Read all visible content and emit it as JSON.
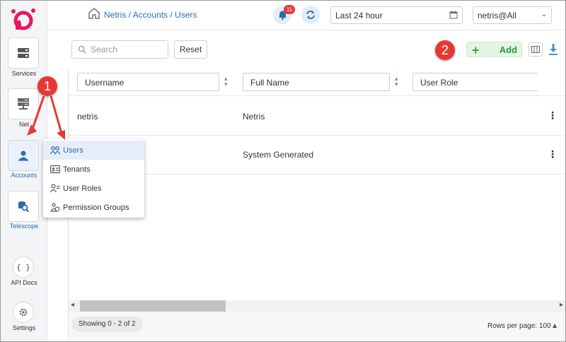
{
  "header": {
    "breadcrumb": "Netris / Accounts / Users",
    "notification_count": "11",
    "time_range": "Last 24 hour",
    "tenant": "netris@All"
  },
  "sidebar": {
    "items": [
      {
        "label": "Services",
        "icon": "services-icon"
      },
      {
        "label": "Net",
        "icon": "net-icon"
      },
      {
        "label": "Accounts",
        "icon": "accounts-icon"
      },
      {
        "label": "Telescope",
        "icon": "telescope-icon"
      },
      {
        "label": "API Docs",
        "icon": "braces-icon",
        "glyph": "{ }"
      },
      {
        "label": "Settings",
        "icon": "gear-icon"
      }
    ]
  },
  "toolbar": {
    "search_placeholder": "Search",
    "reset_label": "Reset",
    "add_label": "Add"
  },
  "table": {
    "filters": [
      "Username",
      "Full Name",
      "User Role"
    ],
    "rows": [
      {
        "username": "netris",
        "full_name": "Netris"
      },
      {
        "username": "",
        "full_name": "System Generated"
      }
    ],
    "showing": "Showing 0 - 2 of 2",
    "rows_per_page_label": "Rows per page:",
    "rows_per_page": "100"
  },
  "menu": {
    "items": [
      {
        "label": "Users",
        "icon": "users-icon",
        "active": true
      },
      {
        "label": "Tenants",
        "icon": "tenants-icon"
      },
      {
        "label": "User Roles",
        "icon": "user-roles-icon"
      },
      {
        "label": "Permission Groups",
        "icon": "permission-groups-icon"
      }
    ]
  },
  "annotations": [
    "1",
    "2"
  ],
  "colors": {
    "accent": "#2b6cb0",
    "brand": "#e8175d",
    "add_green": "#2e9a3a",
    "callout_red": "#e53935"
  }
}
